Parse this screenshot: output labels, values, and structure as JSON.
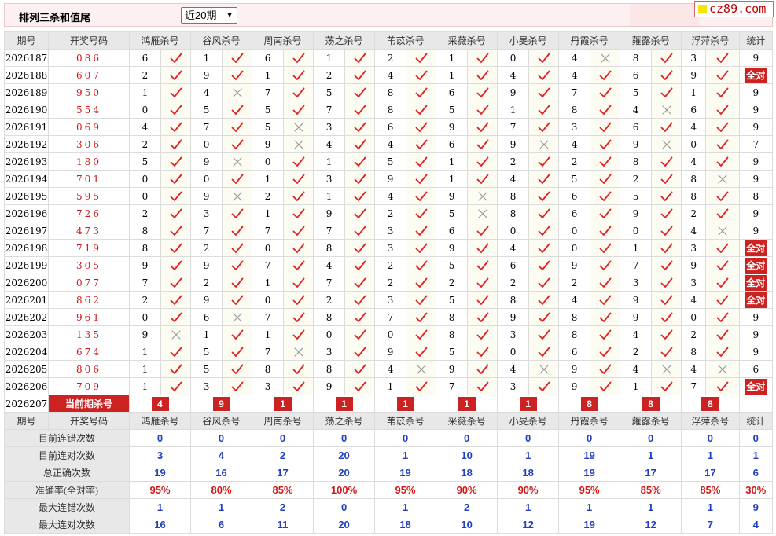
{
  "toolbar": {
    "title": "排列三杀和值尾",
    "period_selected": "近20期",
    "logo_text": "cz89.com"
  },
  "colors": {
    "accent_red": "#cc2222",
    "check_red": "#e02020",
    "value_blue": "#1f3fbf",
    "header_gray": "#e8e8e8"
  },
  "headers": [
    "期号",
    "开奖号码",
    "鸿雁杀号",
    "谷风杀号",
    "周南杀号",
    "荡之杀号",
    "苇苡杀号",
    "采薇杀号",
    "小旻杀号",
    "丹霞杀号",
    "蕹露杀号",
    "浮萍杀号",
    "统计"
  ],
  "rows": [
    {
      "issue": "2026187",
      "code": "086",
      "picks": [
        [
          "6",
          "y"
        ],
        [
          "1",
          "y"
        ],
        [
          "6",
          "y"
        ],
        [
          "1",
          "y"
        ],
        [
          "2",
          "y"
        ],
        [
          "1",
          "y"
        ],
        [
          "0",
          "y"
        ],
        [
          "4",
          "n"
        ],
        [
          "8",
          "y"
        ],
        [
          "3",
          "y"
        ]
      ],
      "stat": "9"
    },
    {
      "issue": "2026188",
      "code": "607",
      "picks": [
        [
          "2",
          "y"
        ],
        [
          "9",
          "y"
        ],
        [
          "1",
          "y"
        ],
        [
          "2",
          "y"
        ],
        [
          "4",
          "y"
        ],
        [
          "1",
          "y"
        ],
        [
          "4",
          "y"
        ],
        [
          "4",
          "y"
        ],
        [
          "6",
          "y"
        ],
        [
          "9",
          "y"
        ]
      ],
      "stat": "全对"
    },
    {
      "issue": "2026189",
      "code": "950",
      "picks": [
        [
          "1",
          "y"
        ],
        [
          "4",
          "n"
        ],
        [
          "7",
          "y"
        ],
        [
          "5",
          "y"
        ],
        [
          "8",
          "y"
        ],
        [
          "6",
          "y"
        ],
        [
          "9",
          "y"
        ],
        [
          "7",
          "y"
        ],
        [
          "5",
          "y"
        ],
        [
          "1",
          "y"
        ]
      ],
      "stat": "9"
    },
    {
      "issue": "2026190",
      "code": "554",
      "picks": [
        [
          "0",
          "y"
        ],
        [
          "5",
          "y"
        ],
        [
          "5",
          "y"
        ],
        [
          "7",
          "y"
        ],
        [
          "8",
          "y"
        ],
        [
          "5",
          "y"
        ],
        [
          "1",
          "y"
        ],
        [
          "8",
          "y"
        ],
        [
          "4",
          "n"
        ],
        [
          "6",
          "y"
        ]
      ],
      "stat": "9"
    },
    {
      "issue": "2026191",
      "code": "069",
      "picks": [
        [
          "4",
          "y"
        ],
        [
          "7",
          "y"
        ],
        [
          "5",
          "n"
        ],
        [
          "3",
          "y"
        ],
        [
          "6",
          "y"
        ],
        [
          "9",
          "y"
        ],
        [
          "7",
          "y"
        ],
        [
          "3",
          "y"
        ],
        [
          "6",
          "y"
        ],
        [
          "4",
          "y"
        ]
      ],
      "stat": "9"
    },
    {
      "issue": "2026192",
      "code": "306",
      "picks": [
        [
          "2",
          "y"
        ],
        [
          "0",
          "y"
        ],
        [
          "9",
          "n"
        ],
        [
          "4",
          "y"
        ],
        [
          "4",
          "y"
        ],
        [
          "6",
          "y"
        ],
        [
          "9",
          "n"
        ],
        [
          "4",
          "y"
        ],
        [
          "9",
          "n"
        ],
        [
          "0",
          "y"
        ]
      ],
      "stat": "7"
    },
    {
      "issue": "2026193",
      "code": "180",
      "picks": [
        [
          "5",
          "y"
        ],
        [
          "9",
          "n"
        ],
        [
          "0",
          "y"
        ],
        [
          "1",
          "y"
        ],
        [
          "5",
          "y"
        ],
        [
          "1",
          "y"
        ],
        [
          "2",
          "y"
        ],
        [
          "2",
          "y"
        ],
        [
          "8",
          "y"
        ],
        [
          "4",
          "y"
        ]
      ],
      "stat": "9"
    },
    {
      "issue": "2026194",
      "code": "701",
      "picks": [
        [
          "0",
          "y"
        ],
        [
          "0",
          "y"
        ],
        [
          "1",
          "y"
        ],
        [
          "3",
          "y"
        ],
        [
          "9",
          "y"
        ],
        [
          "1",
          "y"
        ],
        [
          "4",
          "y"
        ],
        [
          "5",
          "y"
        ],
        [
          "2",
          "y"
        ],
        [
          "8",
          "n"
        ]
      ],
      "stat": "9"
    },
    {
      "issue": "2026195",
      "code": "595",
      "picks": [
        [
          "0",
          "y"
        ],
        [
          "9",
          "n"
        ],
        [
          "2",
          "y"
        ],
        [
          "1",
          "y"
        ],
        [
          "4",
          "y"
        ],
        [
          "9",
          "n"
        ],
        [
          "8",
          "y"
        ],
        [
          "6",
          "y"
        ],
        [
          "5",
          "y"
        ],
        [
          "8",
          "y"
        ]
      ],
      "stat": "8"
    },
    {
      "issue": "2026196",
      "code": "726",
      "picks": [
        [
          "2",
          "y"
        ],
        [
          "3",
          "y"
        ],
        [
          "1",
          "y"
        ],
        [
          "9",
          "y"
        ],
        [
          "2",
          "y"
        ],
        [
          "5",
          "n"
        ],
        [
          "8",
          "y"
        ],
        [
          "6",
          "y"
        ],
        [
          "9",
          "y"
        ],
        [
          "2",
          "y"
        ]
      ],
      "stat": "9"
    },
    {
      "issue": "2026197",
      "code": "473",
      "picks": [
        [
          "8",
          "y"
        ],
        [
          "7",
          "y"
        ],
        [
          "7",
          "y"
        ],
        [
          "7",
          "y"
        ],
        [
          "3",
          "y"
        ],
        [
          "6",
          "y"
        ],
        [
          "0",
          "y"
        ],
        [
          "0",
          "y"
        ],
        [
          "0",
          "y"
        ],
        [
          "4",
          "n"
        ]
      ],
      "stat": "9"
    },
    {
      "issue": "2026198",
      "code": "719",
      "picks": [
        [
          "8",
          "y"
        ],
        [
          "2",
          "y"
        ],
        [
          "0",
          "y"
        ],
        [
          "8",
          "y"
        ],
        [
          "3",
          "y"
        ],
        [
          "9",
          "y"
        ],
        [
          "4",
          "y"
        ],
        [
          "0",
          "y"
        ],
        [
          "1",
          "y"
        ],
        [
          "3",
          "y"
        ]
      ],
      "stat": "全对"
    },
    {
      "issue": "2026199",
      "code": "305",
      "picks": [
        [
          "9",
          "y"
        ],
        [
          "9",
          "y"
        ],
        [
          "7",
          "y"
        ],
        [
          "4",
          "y"
        ],
        [
          "2",
          "y"
        ],
        [
          "5",
          "y"
        ],
        [
          "6",
          "y"
        ],
        [
          "9",
          "y"
        ],
        [
          "7",
          "y"
        ],
        [
          "9",
          "y"
        ]
      ],
      "stat": "全对"
    },
    {
      "issue": "2026200",
      "code": "077",
      "picks": [
        [
          "7",
          "y"
        ],
        [
          "2",
          "y"
        ],
        [
          "1",
          "y"
        ],
        [
          "7",
          "y"
        ],
        [
          "2",
          "y"
        ],
        [
          "2",
          "y"
        ],
        [
          "2",
          "y"
        ],
        [
          "2",
          "y"
        ],
        [
          "3",
          "y"
        ],
        [
          "3",
          "y"
        ]
      ],
      "stat": "全对"
    },
    {
      "issue": "2026201",
      "code": "862",
      "picks": [
        [
          "2",
          "y"
        ],
        [
          "9",
          "y"
        ],
        [
          "0",
          "y"
        ],
        [
          "2",
          "y"
        ],
        [
          "3",
          "y"
        ],
        [
          "5",
          "y"
        ],
        [
          "8",
          "y"
        ],
        [
          "4",
          "y"
        ],
        [
          "9",
          "y"
        ],
        [
          "4",
          "y"
        ]
      ],
      "stat": "全对"
    },
    {
      "issue": "2026202",
      "code": "961",
      "picks": [
        [
          "0",
          "y"
        ],
        [
          "6",
          "n"
        ],
        [
          "7",
          "y"
        ],
        [
          "8",
          "y"
        ],
        [
          "7",
          "y"
        ],
        [
          "8",
          "y"
        ],
        [
          "9",
          "y"
        ],
        [
          "8",
          "y"
        ],
        [
          "9",
          "y"
        ],
        [
          "0",
          "y"
        ]
      ],
      "stat": "9"
    },
    {
      "issue": "2026203",
      "code": "135",
      "picks": [
        [
          "9",
          "n"
        ],
        [
          "1",
          "y"
        ],
        [
          "1",
          "y"
        ],
        [
          "0",
          "y"
        ],
        [
          "0",
          "y"
        ],
        [
          "8",
          "y"
        ],
        [
          "3",
          "y"
        ],
        [
          "8",
          "y"
        ],
        [
          "4",
          "y"
        ],
        [
          "2",
          "y"
        ]
      ],
      "stat": "9"
    },
    {
      "issue": "2026204",
      "code": "674",
      "picks": [
        [
          "1",
          "y"
        ],
        [
          "5",
          "y"
        ],
        [
          "7",
          "n"
        ],
        [
          "3",
          "y"
        ],
        [
          "9",
          "y"
        ],
        [
          "5",
          "y"
        ],
        [
          "0",
          "y"
        ],
        [
          "6",
          "y"
        ],
        [
          "2",
          "y"
        ],
        [
          "8",
          "y"
        ]
      ],
      "stat": "9"
    },
    {
      "issue": "2026205",
      "code": "806",
      "picks": [
        [
          "1",
          "y"
        ],
        [
          "5",
          "y"
        ],
        [
          "8",
          "y"
        ],
        [
          "8",
          "y"
        ],
        [
          "4",
          "n"
        ],
        [
          "9",
          "y"
        ],
        [
          "4",
          "n"
        ],
        [
          "9",
          "y"
        ],
        [
          "4",
          "n"
        ],
        [
          "4",
          "n"
        ]
      ],
      "stat": "6"
    },
    {
      "issue": "2026206",
      "code": "709",
      "picks": [
        [
          "1",
          "y"
        ],
        [
          "3",
          "y"
        ],
        [
          "3",
          "y"
        ],
        [
          "9",
          "y"
        ],
        [
          "1",
          "y"
        ],
        [
          "7",
          "y"
        ],
        [
          "3",
          "y"
        ],
        [
          "9",
          "y"
        ],
        [
          "1",
          "y"
        ],
        [
          "7",
          "y"
        ]
      ],
      "stat": "全对"
    }
  ],
  "current": {
    "issue": "2026207",
    "label": "当前期杀号",
    "kills": [
      "4",
      "9",
      "1",
      "1",
      "1",
      "1",
      "1",
      "8",
      "8",
      "8"
    ]
  },
  "summary": [
    {
      "label": "目前连错次数",
      "values": [
        "0",
        "0",
        "0",
        "0",
        "0",
        "0",
        "0",
        "0",
        "0",
        "0",
        "0"
      ],
      "red": false
    },
    {
      "label": "目前连对次数",
      "values": [
        "3",
        "4",
        "2",
        "20",
        "1",
        "10",
        "1",
        "19",
        "1",
        "1",
        "1"
      ],
      "red": false
    },
    {
      "label": "总正确次数",
      "values": [
        "19",
        "16",
        "17",
        "20",
        "19",
        "18",
        "18",
        "19",
        "17",
        "17",
        "6"
      ],
      "red": false
    },
    {
      "label": "准确率(全对率)",
      "values": [
        "95%",
        "80%",
        "85%",
        "100%",
        "95%",
        "90%",
        "90%",
        "95%",
        "85%",
        "85%",
        "30%"
      ],
      "red": true
    },
    {
      "label": "最大连错次数",
      "values": [
        "1",
        "1",
        "2",
        "0",
        "1",
        "2",
        "1",
        "1",
        "1",
        "1",
        "9"
      ],
      "red": false
    },
    {
      "label": "最大连对次数",
      "values": [
        "16",
        "6",
        "11",
        "20",
        "18",
        "10",
        "12",
        "19",
        "12",
        "7",
        "4"
      ],
      "red": false
    }
  ]
}
